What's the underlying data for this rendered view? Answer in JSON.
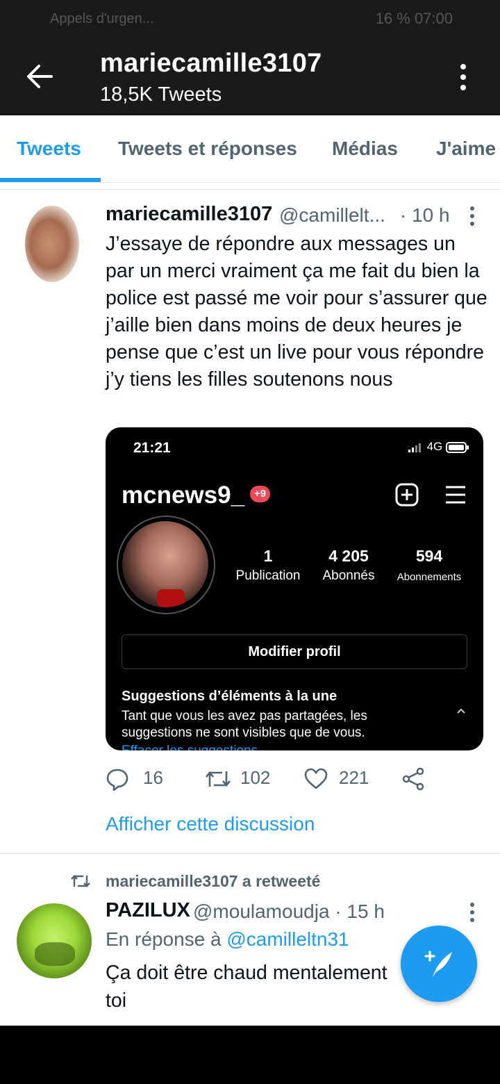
{
  "status_bar": {
    "left": "Appels d'urgen...",
    "right": "16 % 07:00"
  },
  "header": {
    "title": "mariecamille3107",
    "subtitle": "18,5K Tweets"
  },
  "tabs": [
    {
      "label": "Tweets",
      "active": true
    },
    {
      "label": "Tweets et réponses",
      "active": false
    },
    {
      "label": "Médias",
      "active": false
    },
    {
      "label": "J'aime",
      "active": false
    }
  ],
  "tweet1": {
    "name": "mariecamille3107",
    "handle": "@camillelt...",
    "time": "· 10 h",
    "text": "J’essaye de répondre aux messages un par un merci vraiment ça me fait du bien la police est passé me voir pour s’assurer que j’aille bien dans moins de deux heures je pense que c’est un live pour vous répondre j’y tiens les filles soutenons nous",
    "embed": {
      "time": "21:21",
      "network": "4G",
      "username": "mcnews9_",
      "badge": "+9",
      "stats": [
        {
          "value": "1",
          "label": "Publication"
        },
        {
          "value": "4 205",
          "label": "Abonnés"
        },
        {
          "value": "594",
          "label": "Abonnements"
        }
      ],
      "edit_button": "Modifier profil",
      "suggestions_title": "Suggestions d’éléments à la une",
      "suggestions_text": "Tant que vous les avez pas partagées, les suggestions ne sont visibles que de vous.",
      "suggestions_link": "Effacer les suggestions"
    },
    "replies": "16",
    "retweets": "102",
    "likes": "221",
    "show_thread": "Afficher cette discussion"
  },
  "retweet_label": "mariecamille3107 a retweeté",
  "tweet2": {
    "name": "PAZILUX",
    "handle": "@moulamoudja · 15 h",
    "reply_prefix": "En réponse à",
    "reply_mention": "@camilleltn31",
    "text": "Ça doit être chaud mentalement toi"
  },
  "colors": {
    "accent": "#1d9bf0",
    "header_bg": "#1a1a1a",
    "muted": "#536471"
  },
  "icons": [
    "arrow-left-icon",
    "more-vertical-icon",
    "more-horizontal-icon",
    "reply-icon",
    "retweet-icon",
    "like-icon",
    "share-icon",
    "compose-icon"
  ]
}
